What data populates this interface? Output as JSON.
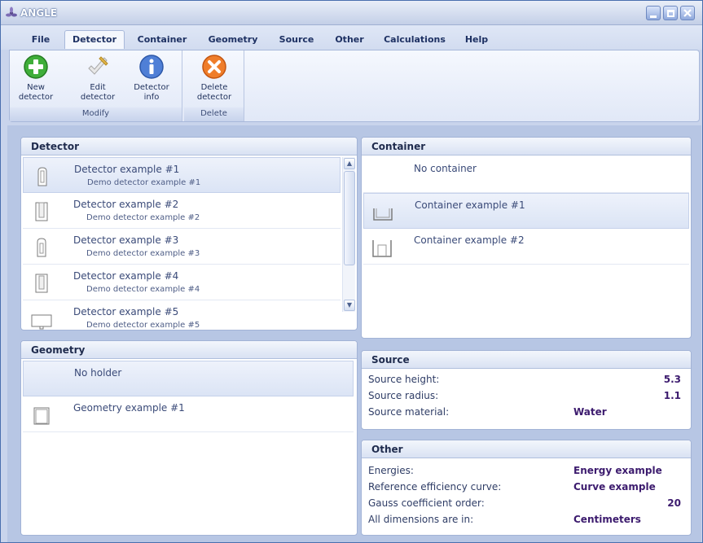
{
  "window": {
    "title": "ANGLE"
  },
  "menu": [
    {
      "label": "File",
      "active": false
    },
    {
      "label": "Detector",
      "active": true
    },
    {
      "label": "Container",
      "active": false
    },
    {
      "label": "Geometry",
      "active": false
    },
    {
      "label": "Source",
      "active": false
    },
    {
      "label": "Other",
      "active": false
    },
    {
      "label": "Calculations",
      "active": false
    },
    {
      "label": "Help",
      "active": false
    }
  ],
  "ribbon": {
    "modify_group": "Modify",
    "delete_group": "Delete",
    "new_detector": {
      "line1": "New",
      "line2": "detector",
      "icon": "plus-icon"
    },
    "edit_detector": {
      "line1": "Edit",
      "line2": "detector",
      "icon": "edit-icon"
    },
    "detector_info": {
      "line1": "Detector",
      "line2": "info",
      "icon": "info-icon"
    },
    "delete_detector": {
      "line1": "Delete",
      "line2": "detector",
      "icon": "delete-icon"
    }
  },
  "detector_panel": {
    "title": "Detector",
    "items": [
      {
        "name": "Detector example #1",
        "desc": "Demo detector example #1",
        "selected": true
      },
      {
        "name": "Detector example #2",
        "desc": "Demo detector example #2",
        "selected": false
      },
      {
        "name": "Detector example #3",
        "desc": "Demo detector example #3",
        "selected": false
      },
      {
        "name": "Detector example #4",
        "desc": "Demo detector example #4",
        "selected": false
      },
      {
        "name": "Detector example #5",
        "desc": "Demo detector example #5",
        "selected": false
      }
    ]
  },
  "container_panel": {
    "title": "Container",
    "items": [
      {
        "name": "No container",
        "selected": false
      },
      {
        "name": "Container example #1",
        "selected": true
      },
      {
        "name": "Container example #2",
        "selected": false
      }
    ]
  },
  "geometry_panel": {
    "title": "Geometry",
    "items": [
      {
        "name": "No holder",
        "selected": true
      },
      {
        "name": "Geometry example #1",
        "selected": false
      }
    ]
  },
  "source_panel": {
    "title": "Source",
    "rows": [
      {
        "label": "Source height:",
        "value": "5.3"
      },
      {
        "label": "Source radius:",
        "value": "1.1"
      },
      {
        "label": "Source material:",
        "value": "Water"
      }
    ]
  },
  "other_panel": {
    "title": "Other",
    "rows": [
      {
        "label": "Energies:",
        "value": "Energy example"
      },
      {
        "label": "Reference efficiency curve:",
        "value": "Curve example"
      },
      {
        "label": "Gauss coefficient order:",
        "value": "20"
      },
      {
        "label": "All dimensions are in:",
        "value": "Centimeters"
      }
    ]
  },
  "colors": {
    "accent": "#1e3163",
    "value_text": "#3c1b6e",
    "selection": "#dbe4f5"
  }
}
